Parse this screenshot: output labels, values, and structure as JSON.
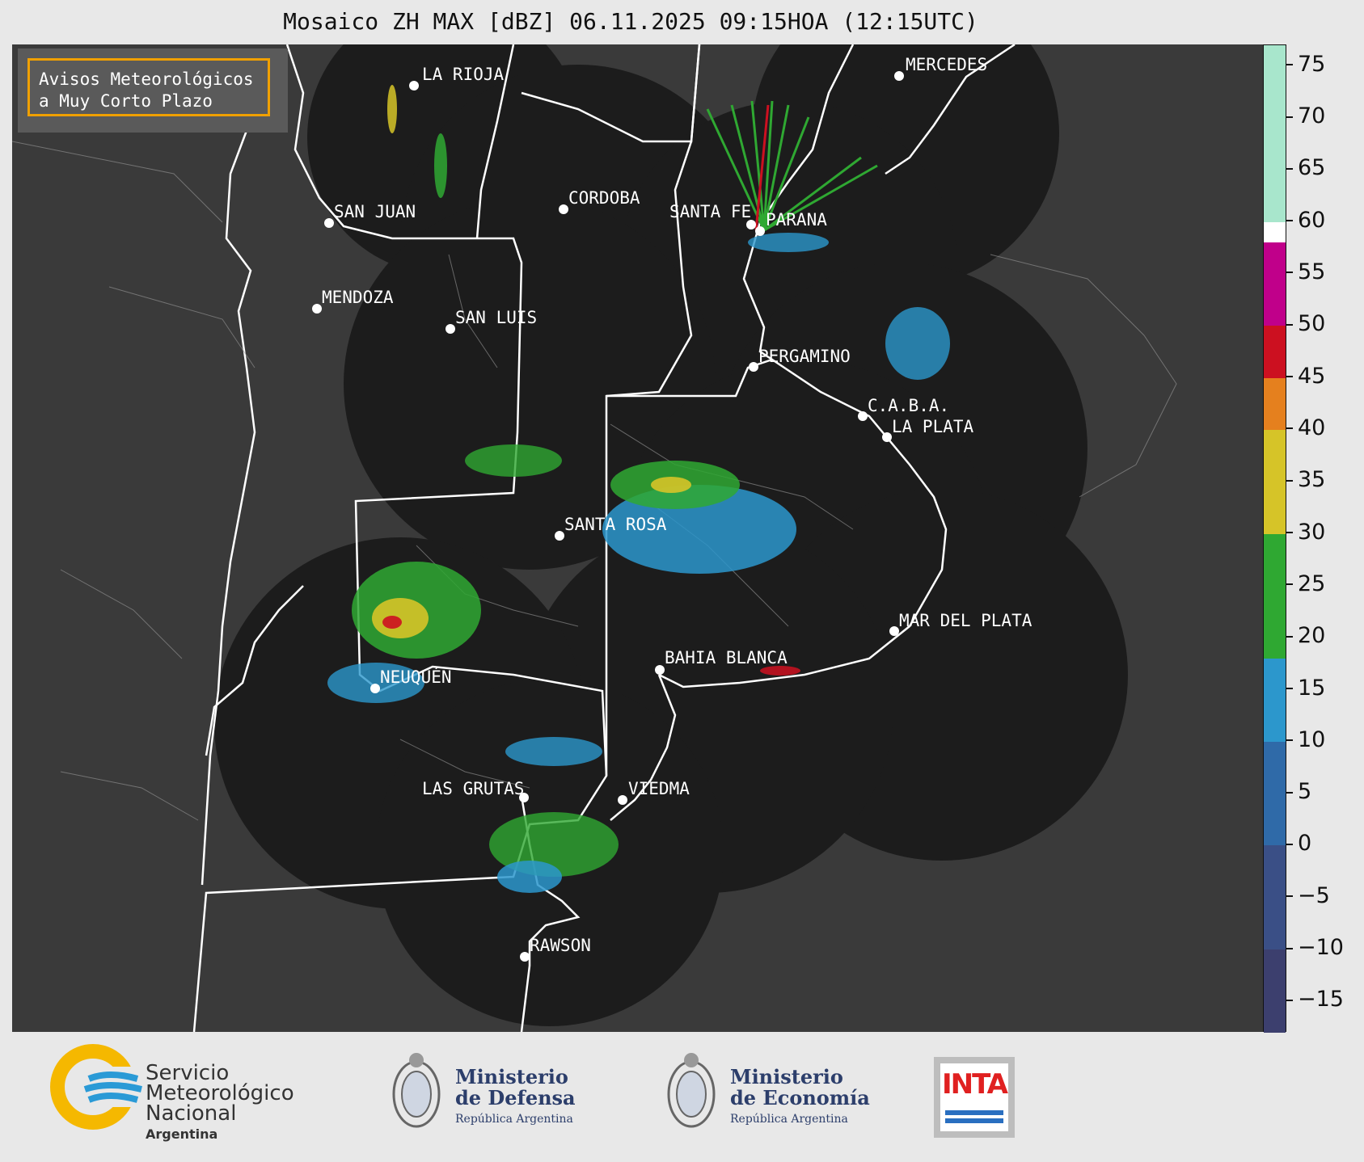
{
  "title": "Mosaico ZH MAX [dBZ] 06.11.2025 09:15HOA (12:15UTC)",
  "badge": {
    "line1": "Avisos Meteorológicos",
    "line2": "a Muy Corto Plazo"
  },
  "colors": {
    "map_background": "#3a3a3a",
    "radar_coverage": "#1c1c1c",
    "borders": "#ffffff",
    "badge_border": "#f0a000"
  },
  "colorbar": {
    "unit": "dBZ",
    "min": -18,
    "max": 77,
    "ticks": [
      "75",
      "70",
      "65",
      "60",
      "55",
      "50",
      "45",
      "40",
      "35",
      "30",
      "25",
      "20",
      "15",
      "10",
      "5",
      "0",
      "−5",
      "−10",
      "−15"
    ],
    "tick_values": [
      75,
      70,
      65,
      60,
      55,
      50,
      45,
      40,
      35,
      30,
      25,
      20,
      15,
      10,
      5,
      0,
      -5,
      -10,
      -15
    ],
    "bands": [
      {
        "from": -18,
        "to": -10,
        "color": "#3c3f6e"
      },
      {
        "from": -10,
        "to": 0,
        "color": "#3a4f86"
      },
      {
        "from": 0,
        "to": 10,
        "color": "#2f6aa8"
      },
      {
        "from": 10,
        "to": 18,
        "color": "#2c97cc"
      },
      {
        "from": 18,
        "to": 30,
        "color": "#2fa832"
      },
      {
        "from": 30,
        "to": 40,
        "color": "#d6c428"
      },
      {
        "from": 40,
        "to": 45,
        "color": "#e5801e"
      },
      {
        "from": 45,
        "to": 50,
        "color": "#cc1020"
      },
      {
        "from": 50,
        "to": 58,
        "color": "#c0008a"
      },
      {
        "from": 58,
        "to": 60,
        "color": "#ffffff"
      },
      {
        "from": 60,
        "to": 77,
        "color": "#a8e6cc"
      }
    ]
  },
  "cities": [
    "LA RIOJA",
    "MERCEDES",
    "SAN JUAN",
    "CORDOBA",
    "SANTA FE",
    "PARANA",
    "MENDOZA",
    "SAN LUIS",
    "PERGAMINO",
    "C.A.B.A.",
    "LA PLATA",
    "SANTA ROSA",
    "NEUQUÉN",
    "BAHIA BLANCA",
    "MAR DEL PLATA",
    "LAS GRUTAS",
    "VIEDMA",
    "RAWSON"
  ],
  "footer": {
    "smn": {
      "l1": "Servicio",
      "l2": "Meteorológico",
      "l3": "Nacional",
      "l4": "Argentina"
    },
    "defensa": {
      "l1": "Ministerio",
      "l2": "de Defensa",
      "l3": "República Argentina"
    },
    "economia": {
      "l1": "Ministerio",
      "l2": "de Economía",
      "l3": "República Argentina"
    },
    "inta": {
      "label": "INTA"
    }
  }
}
